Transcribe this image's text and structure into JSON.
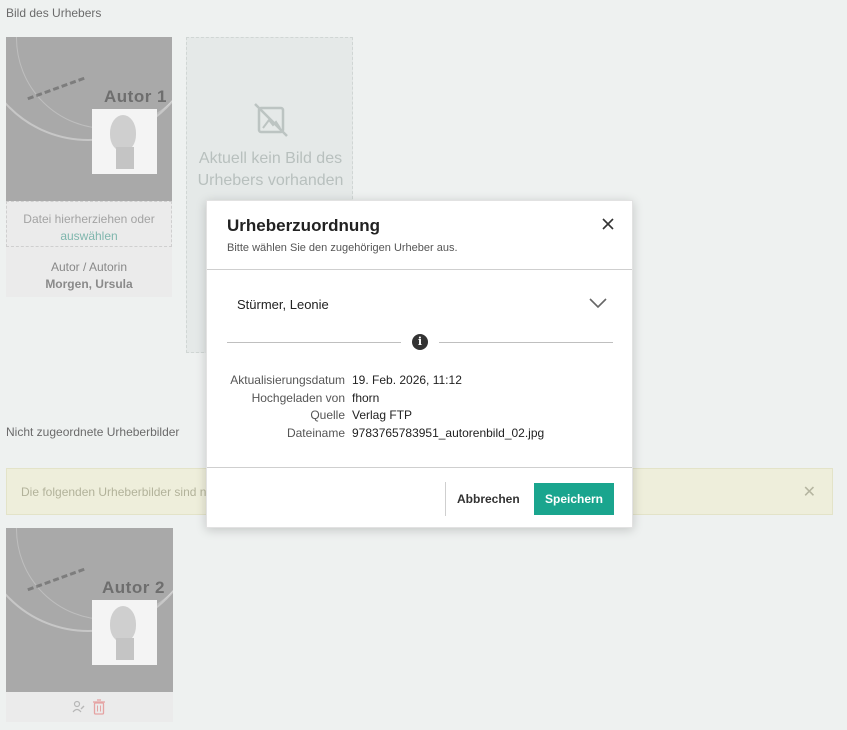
{
  "page": {
    "section_author_image": "Bild des Urhebers",
    "section_unassigned": "Nicht zugeordnete Urheberbilder"
  },
  "card1": {
    "image_text": "Autor 1",
    "drop_text": "Datei hierherziehen oder",
    "drop_link": "auswählen",
    "role": "Autor / Autorin",
    "name": "Morgen, Ursula"
  },
  "empty_card": {
    "text": "Aktuell kein Bild des Urhebers vorhanden"
  },
  "warning": {
    "text": "Die folgenden Urheberbilder sind nc"
  },
  "card2": {
    "image_text": "Autor 2"
  },
  "modal": {
    "title": "Urheberzuordnung",
    "subtitle": "Bitte wählen Sie den zugehörigen Urheber aus.",
    "selected": "Stürmer, Leonie",
    "rows": [
      {
        "key": "Aktualisierungsdatum",
        "value": "19. Feb. 2026, 11:12"
      },
      {
        "key": "Hochgeladen von",
        "value": "fhorn"
      },
      {
        "key": "Quelle",
        "value": "Verlag FTP"
      },
      {
        "key": "Dateiname",
        "value": "9783765783951_autorenbild_02.jpg"
      }
    ],
    "cancel_label": "Abbrechen",
    "save_label": "Speichern",
    "accent_color": "#1aa58e"
  }
}
